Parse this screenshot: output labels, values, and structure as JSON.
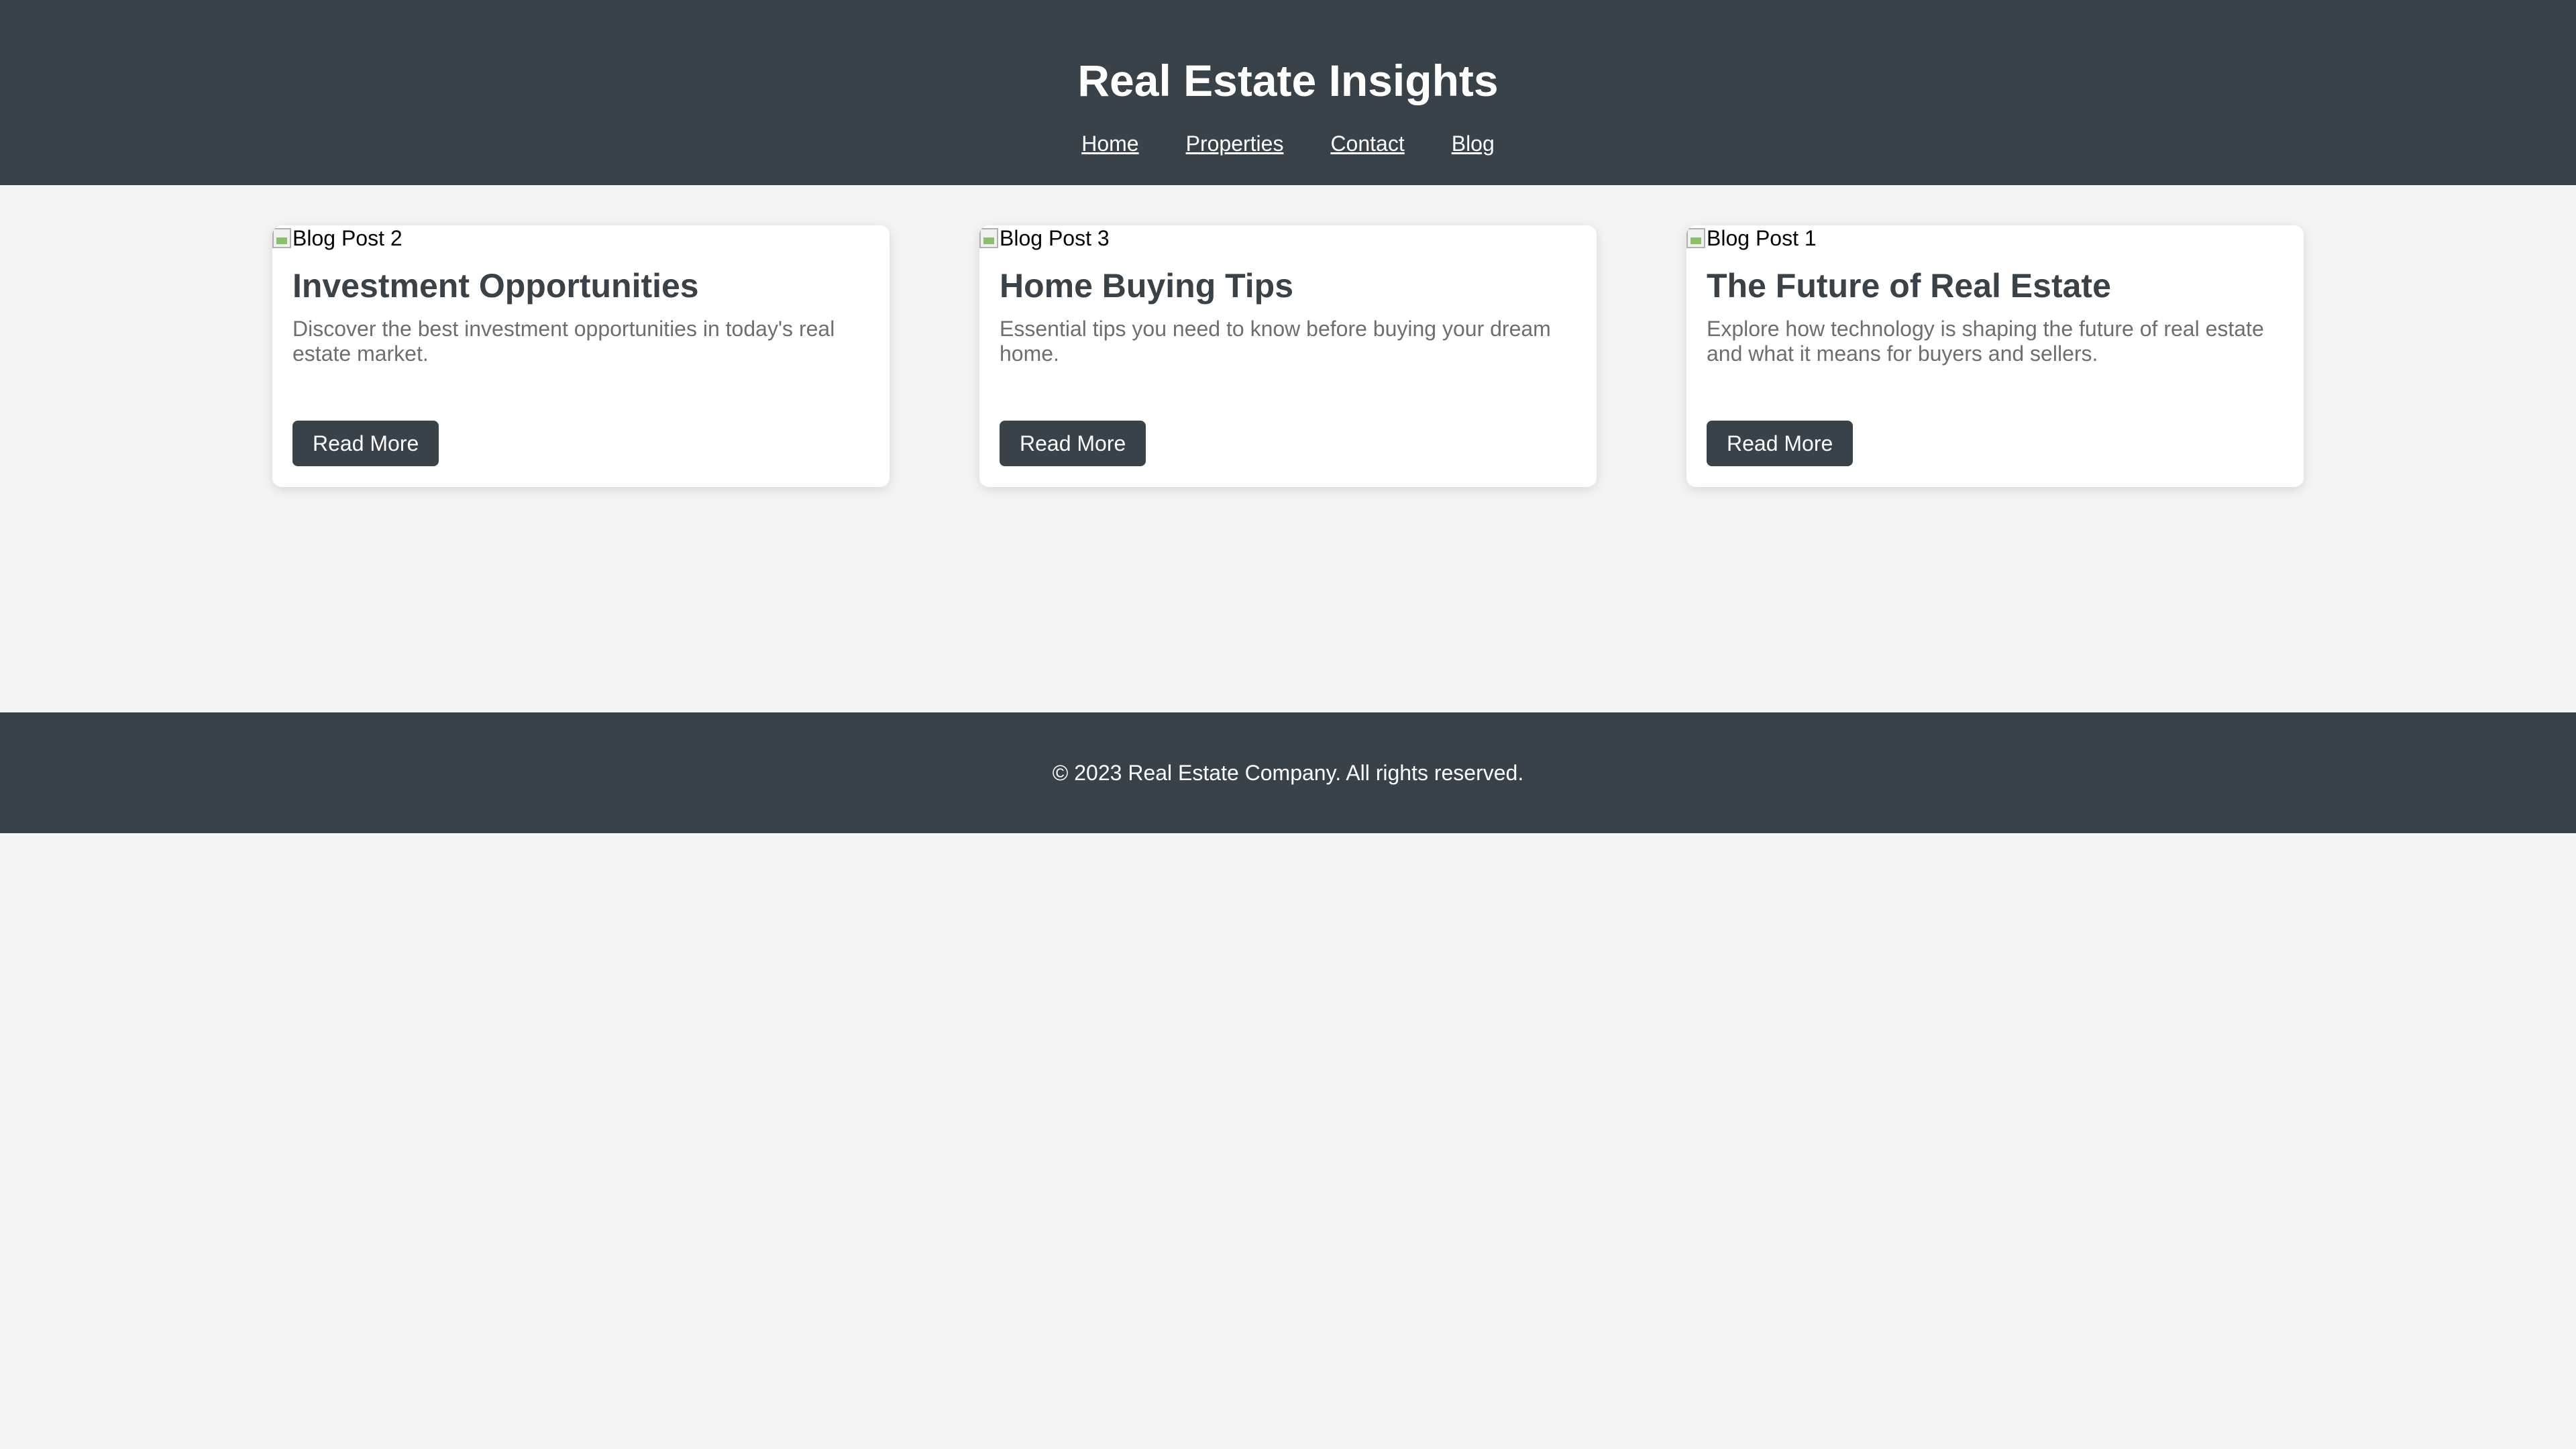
{
  "header": {
    "title": "Real Estate Insights",
    "nav": [
      "Home",
      "Properties",
      "Contact",
      "Blog"
    ]
  },
  "posts": [
    {
      "image_alt": "Blog Post 2",
      "title": "Investment Opportunities",
      "excerpt": "Discover the best investment opportunities in today's real estate market.",
      "button_label": "Read More"
    },
    {
      "image_alt": "Blog Post 3",
      "title": "Home Buying Tips",
      "excerpt": "Essential tips you need to know before buying your dream home.",
      "button_label": "Read More"
    },
    {
      "image_alt": "Blog Post 1",
      "title": "The Future of Real Estate",
      "excerpt": "Explore how technology is shaping the future of real estate and what it means for buyers and sellers.",
      "button_label": "Read More"
    }
  ],
  "footer": {
    "copyright": "© 2023 Real Estate Company. All rights reserved."
  },
  "colors": {
    "header_bg": "#394248",
    "page_bg": "#f4f4f4",
    "card_bg": "#ffffff",
    "excerpt_text": "#6e6e6e"
  }
}
